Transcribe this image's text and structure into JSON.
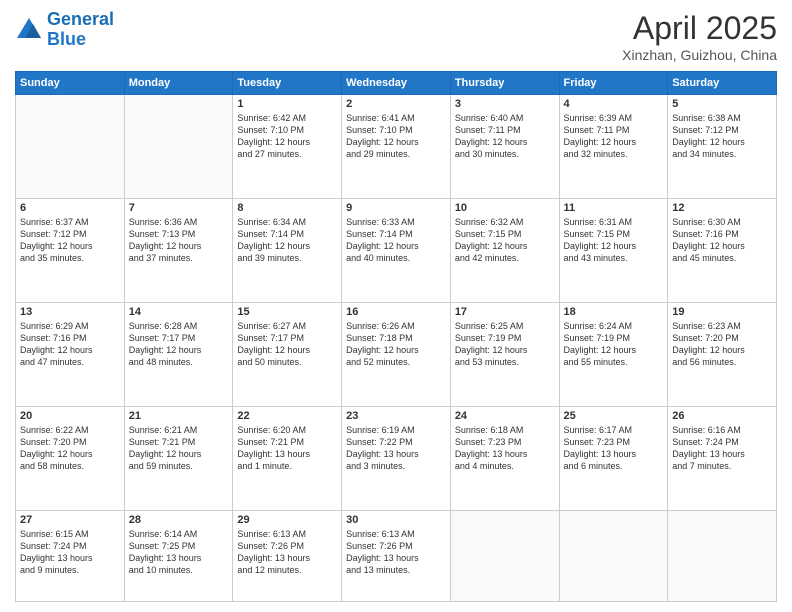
{
  "header": {
    "logo_line1": "General",
    "logo_line2": "Blue",
    "title": "April 2025",
    "subtitle": "Xinzhan, Guizhou, China"
  },
  "calendar": {
    "days_of_week": [
      "Sunday",
      "Monday",
      "Tuesday",
      "Wednesday",
      "Thursday",
      "Friday",
      "Saturday"
    ],
    "weeks": [
      [
        {
          "day": "",
          "info": ""
        },
        {
          "day": "",
          "info": ""
        },
        {
          "day": "1",
          "info": "Sunrise: 6:42 AM\nSunset: 7:10 PM\nDaylight: 12 hours\nand 27 minutes."
        },
        {
          "day": "2",
          "info": "Sunrise: 6:41 AM\nSunset: 7:10 PM\nDaylight: 12 hours\nand 29 minutes."
        },
        {
          "day": "3",
          "info": "Sunrise: 6:40 AM\nSunset: 7:11 PM\nDaylight: 12 hours\nand 30 minutes."
        },
        {
          "day": "4",
          "info": "Sunrise: 6:39 AM\nSunset: 7:11 PM\nDaylight: 12 hours\nand 32 minutes."
        },
        {
          "day": "5",
          "info": "Sunrise: 6:38 AM\nSunset: 7:12 PM\nDaylight: 12 hours\nand 34 minutes."
        }
      ],
      [
        {
          "day": "6",
          "info": "Sunrise: 6:37 AM\nSunset: 7:12 PM\nDaylight: 12 hours\nand 35 minutes."
        },
        {
          "day": "7",
          "info": "Sunrise: 6:36 AM\nSunset: 7:13 PM\nDaylight: 12 hours\nand 37 minutes."
        },
        {
          "day": "8",
          "info": "Sunrise: 6:34 AM\nSunset: 7:14 PM\nDaylight: 12 hours\nand 39 minutes."
        },
        {
          "day": "9",
          "info": "Sunrise: 6:33 AM\nSunset: 7:14 PM\nDaylight: 12 hours\nand 40 minutes."
        },
        {
          "day": "10",
          "info": "Sunrise: 6:32 AM\nSunset: 7:15 PM\nDaylight: 12 hours\nand 42 minutes."
        },
        {
          "day": "11",
          "info": "Sunrise: 6:31 AM\nSunset: 7:15 PM\nDaylight: 12 hours\nand 43 minutes."
        },
        {
          "day": "12",
          "info": "Sunrise: 6:30 AM\nSunset: 7:16 PM\nDaylight: 12 hours\nand 45 minutes."
        }
      ],
      [
        {
          "day": "13",
          "info": "Sunrise: 6:29 AM\nSunset: 7:16 PM\nDaylight: 12 hours\nand 47 minutes."
        },
        {
          "day": "14",
          "info": "Sunrise: 6:28 AM\nSunset: 7:17 PM\nDaylight: 12 hours\nand 48 minutes."
        },
        {
          "day": "15",
          "info": "Sunrise: 6:27 AM\nSunset: 7:17 PM\nDaylight: 12 hours\nand 50 minutes."
        },
        {
          "day": "16",
          "info": "Sunrise: 6:26 AM\nSunset: 7:18 PM\nDaylight: 12 hours\nand 52 minutes."
        },
        {
          "day": "17",
          "info": "Sunrise: 6:25 AM\nSunset: 7:19 PM\nDaylight: 12 hours\nand 53 minutes."
        },
        {
          "day": "18",
          "info": "Sunrise: 6:24 AM\nSunset: 7:19 PM\nDaylight: 12 hours\nand 55 minutes."
        },
        {
          "day": "19",
          "info": "Sunrise: 6:23 AM\nSunset: 7:20 PM\nDaylight: 12 hours\nand 56 minutes."
        }
      ],
      [
        {
          "day": "20",
          "info": "Sunrise: 6:22 AM\nSunset: 7:20 PM\nDaylight: 12 hours\nand 58 minutes."
        },
        {
          "day": "21",
          "info": "Sunrise: 6:21 AM\nSunset: 7:21 PM\nDaylight: 12 hours\nand 59 minutes."
        },
        {
          "day": "22",
          "info": "Sunrise: 6:20 AM\nSunset: 7:21 PM\nDaylight: 13 hours\nand 1 minute."
        },
        {
          "day": "23",
          "info": "Sunrise: 6:19 AM\nSunset: 7:22 PM\nDaylight: 13 hours\nand 3 minutes."
        },
        {
          "day": "24",
          "info": "Sunrise: 6:18 AM\nSunset: 7:23 PM\nDaylight: 13 hours\nand 4 minutes."
        },
        {
          "day": "25",
          "info": "Sunrise: 6:17 AM\nSunset: 7:23 PM\nDaylight: 13 hours\nand 6 minutes."
        },
        {
          "day": "26",
          "info": "Sunrise: 6:16 AM\nSunset: 7:24 PM\nDaylight: 13 hours\nand 7 minutes."
        }
      ],
      [
        {
          "day": "27",
          "info": "Sunrise: 6:15 AM\nSunset: 7:24 PM\nDaylight: 13 hours\nand 9 minutes."
        },
        {
          "day": "28",
          "info": "Sunrise: 6:14 AM\nSunset: 7:25 PM\nDaylight: 13 hours\nand 10 minutes."
        },
        {
          "day": "29",
          "info": "Sunrise: 6:13 AM\nSunset: 7:26 PM\nDaylight: 13 hours\nand 12 minutes."
        },
        {
          "day": "30",
          "info": "Sunrise: 6:13 AM\nSunset: 7:26 PM\nDaylight: 13 hours\nand 13 minutes."
        },
        {
          "day": "",
          "info": ""
        },
        {
          "day": "",
          "info": ""
        },
        {
          "day": "",
          "info": ""
        }
      ]
    ]
  }
}
